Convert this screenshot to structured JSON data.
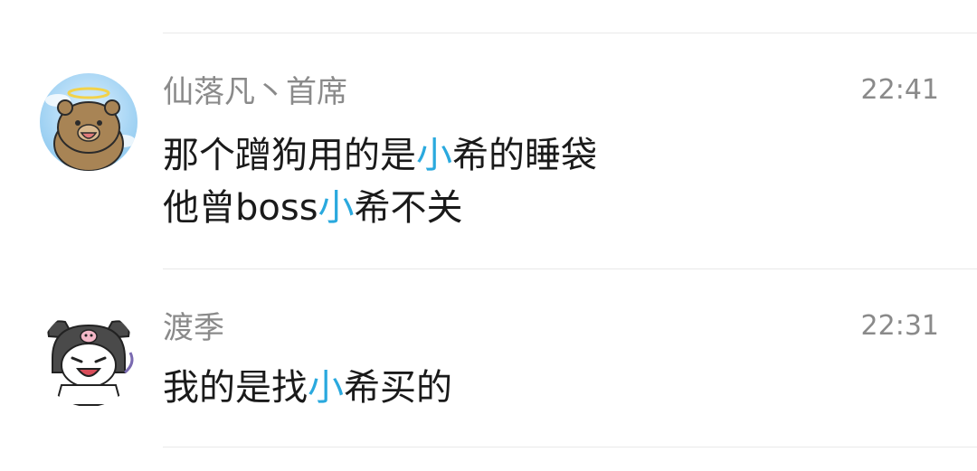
{
  "comments": [
    {
      "sender": "仙落凡丶首席",
      "time": "22:41",
      "avatar_icon": "bear-angel-avatar",
      "lines": [
        [
          "那个蹭狗用的是",
          "小",
          "希的睡袋"
        ],
        [
          "他曾boss",
          "小",
          "希不关"
        ]
      ]
    },
    {
      "sender": "渡季",
      "time": "22:31",
      "avatar_icon": "kuromi-avatar",
      "lines": [
        [
          "我的是找",
          "小",
          "希买的"
        ]
      ]
    }
  ],
  "colors": {
    "highlight": "#2aa9de",
    "meta_text": "#8a8a8a",
    "body_text": "#1a1a1a",
    "divider": "#e9e9e9"
  }
}
